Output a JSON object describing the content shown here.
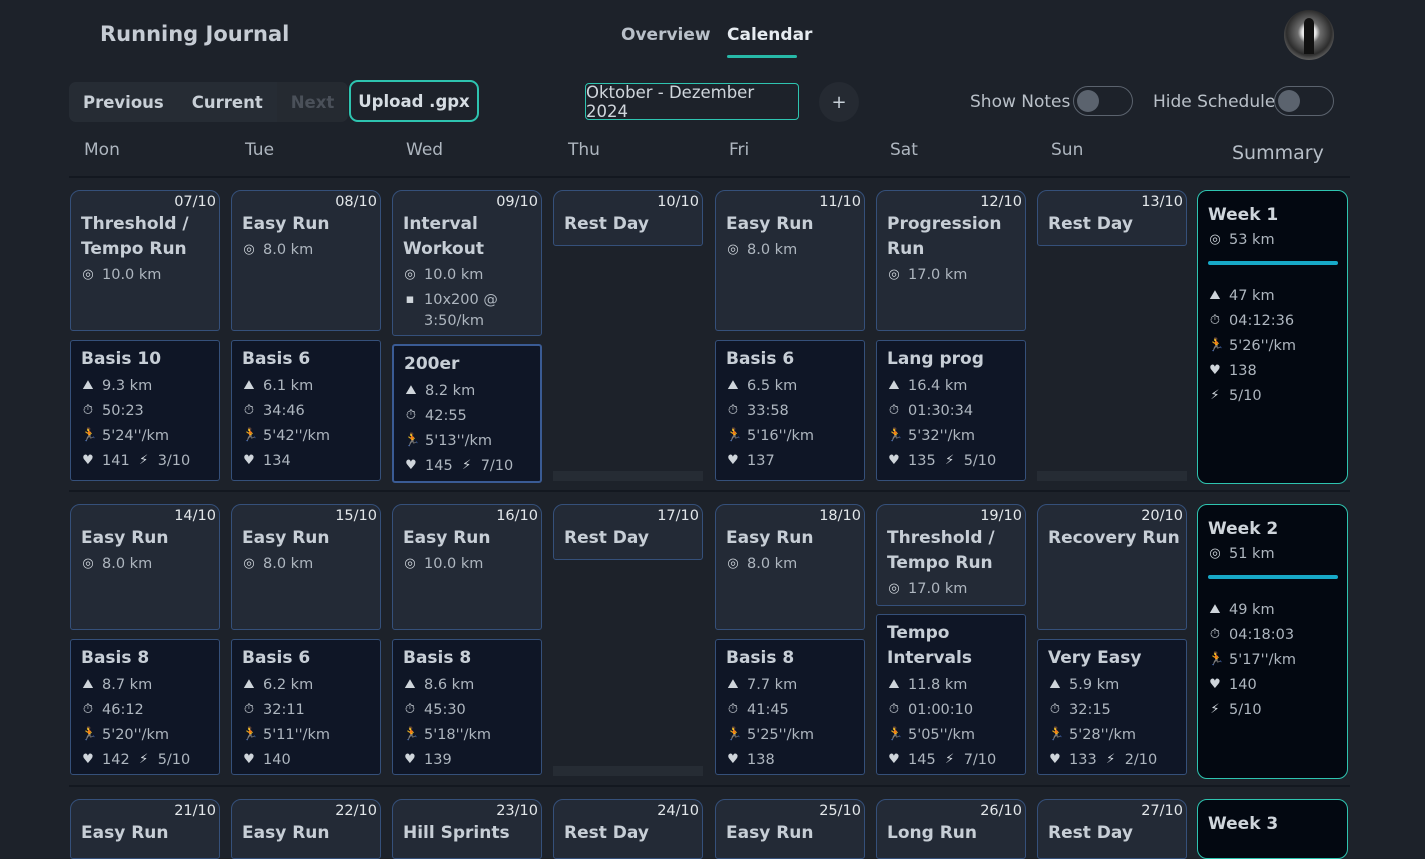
{
  "header": {
    "title": "Running Journal",
    "tabs": [
      {
        "label": "Overview"
      },
      {
        "label": "Calendar"
      }
    ]
  },
  "toolbar": {
    "previous": "Previous",
    "current": "Current",
    "next": "Next",
    "upload": "Upload .gpx",
    "range": "Oktober - Dezember 2024",
    "plus": "+",
    "show_notes": "Show Notes",
    "hide_schedule": "Hide Schedule"
  },
  "days": [
    "Mon",
    "Tue",
    "Wed",
    "Thu",
    "Fri",
    "Sat",
    "Sun"
  ],
  "summary_label": "Summary",
  "accent": "#2ec4b0",
  "week1": {
    "plan": [
      {
        "date": "07/10",
        "title": "Threshold /",
        "title2": "Tempo Run",
        "dist": "10.0 km"
      },
      {
        "date": "08/10",
        "title": "Easy Run",
        "dist": "8.0 km"
      },
      {
        "date": "09/10",
        "title": "Interval",
        "title2": "Workout",
        "dist": "10.0 km",
        "note": "10x200 @",
        "note2": "3:50/km"
      },
      {
        "date": "10/10",
        "title": "Rest Day"
      },
      {
        "date": "11/10",
        "title": "Easy Run",
        "dist": "8.0 km"
      },
      {
        "date": "12/10",
        "title": "Progression",
        "title2": "Run",
        "dist": "17.0 km"
      },
      {
        "date": "13/10",
        "title": "Rest Day"
      }
    ],
    "acts": [
      {
        "title": "Basis 10",
        "dist": "9.3 km",
        "time": "50:23",
        "pace": "5'24''/km",
        "hr": "141",
        "effort": "3/10"
      },
      {
        "title": "Basis 6",
        "dist": "6.1 km",
        "time": "34:46",
        "pace": "5'42''/km",
        "hr": "134"
      },
      {
        "title": "200er",
        "dist": "8.2 km",
        "time": "42:55",
        "pace": "5'13''/km",
        "hr": "145",
        "effort": "7/10"
      },
      {},
      {
        "title": "Basis 6",
        "dist": "6.5 km",
        "time": "33:58",
        "pace": "5'16''/km",
        "hr": "137"
      },
      {
        "title": "Lang prog",
        "dist": "16.4 km",
        "time": "01:30:34",
        "pace": "5'32''/km",
        "hr": "135",
        "effort": "5/10"
      },
      {}
    ],
    "summary": {
      "title": "Week 1",
      "planned": "53 km",
      "dist": "47 km",
      "time": "04:12:36",
      "pace": "5'26''/km",
      "hr": "138",
      "effort": "5/10"
    }
  },
  "week2": {
    "plan": [
      {
        "date": "14/10",
        "title": "Easy Run",
        "dist": "8.0 km"
      },
      {
        "date": "15/10",
        "title": "Easy Run",
        "dist": "8.0 km"
      },
      {
        "date": "16/10",
        "title": "Easy Run",
        "dist": "10.0 km"
      },
      {
        "date": "17/10",
        "title": "Rest Day"
      },
      {
        "date": "18/10",
        "title": "Easy Run",
        "dist": "8.0 km"
      },
      {
        "date": "19/10",
        "title": "Threshold /",
        "title2": "Tempo Run",
        "dist": "17.0 km"
      },
      {
        "date": "20/10",
        "title": "Recovery Run"
      }
    ],
    "acts": [
      {
        "title": "Basis 8",
        "dist": "8.7 km",
        "time": "46:12",
        "pace": "5'20''/km",
        "hr": "142",
        "effort": "5/10"
      },
      {
        "title": "Basis 6",
        "dist": "6.2 km",
        "time": "32:11",
        "pace": "5'11''/km",
        "hr": "140"
      },
      {
        "title": "Basis 8",
        "dist": "8.6 km",
        "time": "45:30",
        "pace": "5'18''/km",
        "hr": "139"
      },
      {},
      {
        "title": "Basis 8",
        "dist": "7.7 km",
        "time": "41:45",
        "pace": "5'25''/km",
        "hr": "138"
      },
      {
        "title": "Tempo",
        "title2": "Intervals",
        "dist": "11.8 km",
        "time": "01:00:10",
        "pace": "5'05''/km",
        "hr": "145",
        "effort": "7/10"
      },
      {
        "title": "Very Easy",
        "dist": "5.9 km",
        "time": "32:15",
        "pace": "5'28''/km",
        "hr": "133",
        "effort": "2/10"
      }
    ],
    "summary": {
      "title": "Week 2",
      "planned": "51 km",
      "dist": "49 km",
      "time": "04:18:03",
      "pace": "5'17''/km",
      "hr": "140",
      "effort": "5/10"
    }
  },
  "week3": {
    "plan": [
      {
        "date": "21/10",
        "title": "Easy Run"
      },
      {
        "date": "22/10",
        "title": "Easy Run"
      },
      {
        "date": "23/10",
        "title": "Hill Sprints"
      },
      {
        "date": "24/10",
        "title": "Rest Day"
      },
      {
        "date": "25/10",
        "title": "Easy Run"
      },
      {
        "date": "26/10",
        "title": "Long Run"
      },
      {
        "date": "27/10",
        "title": "Rest Day"
      }
    ],
    "summary": {
      "title": "Week 3"
    }
  }
}
